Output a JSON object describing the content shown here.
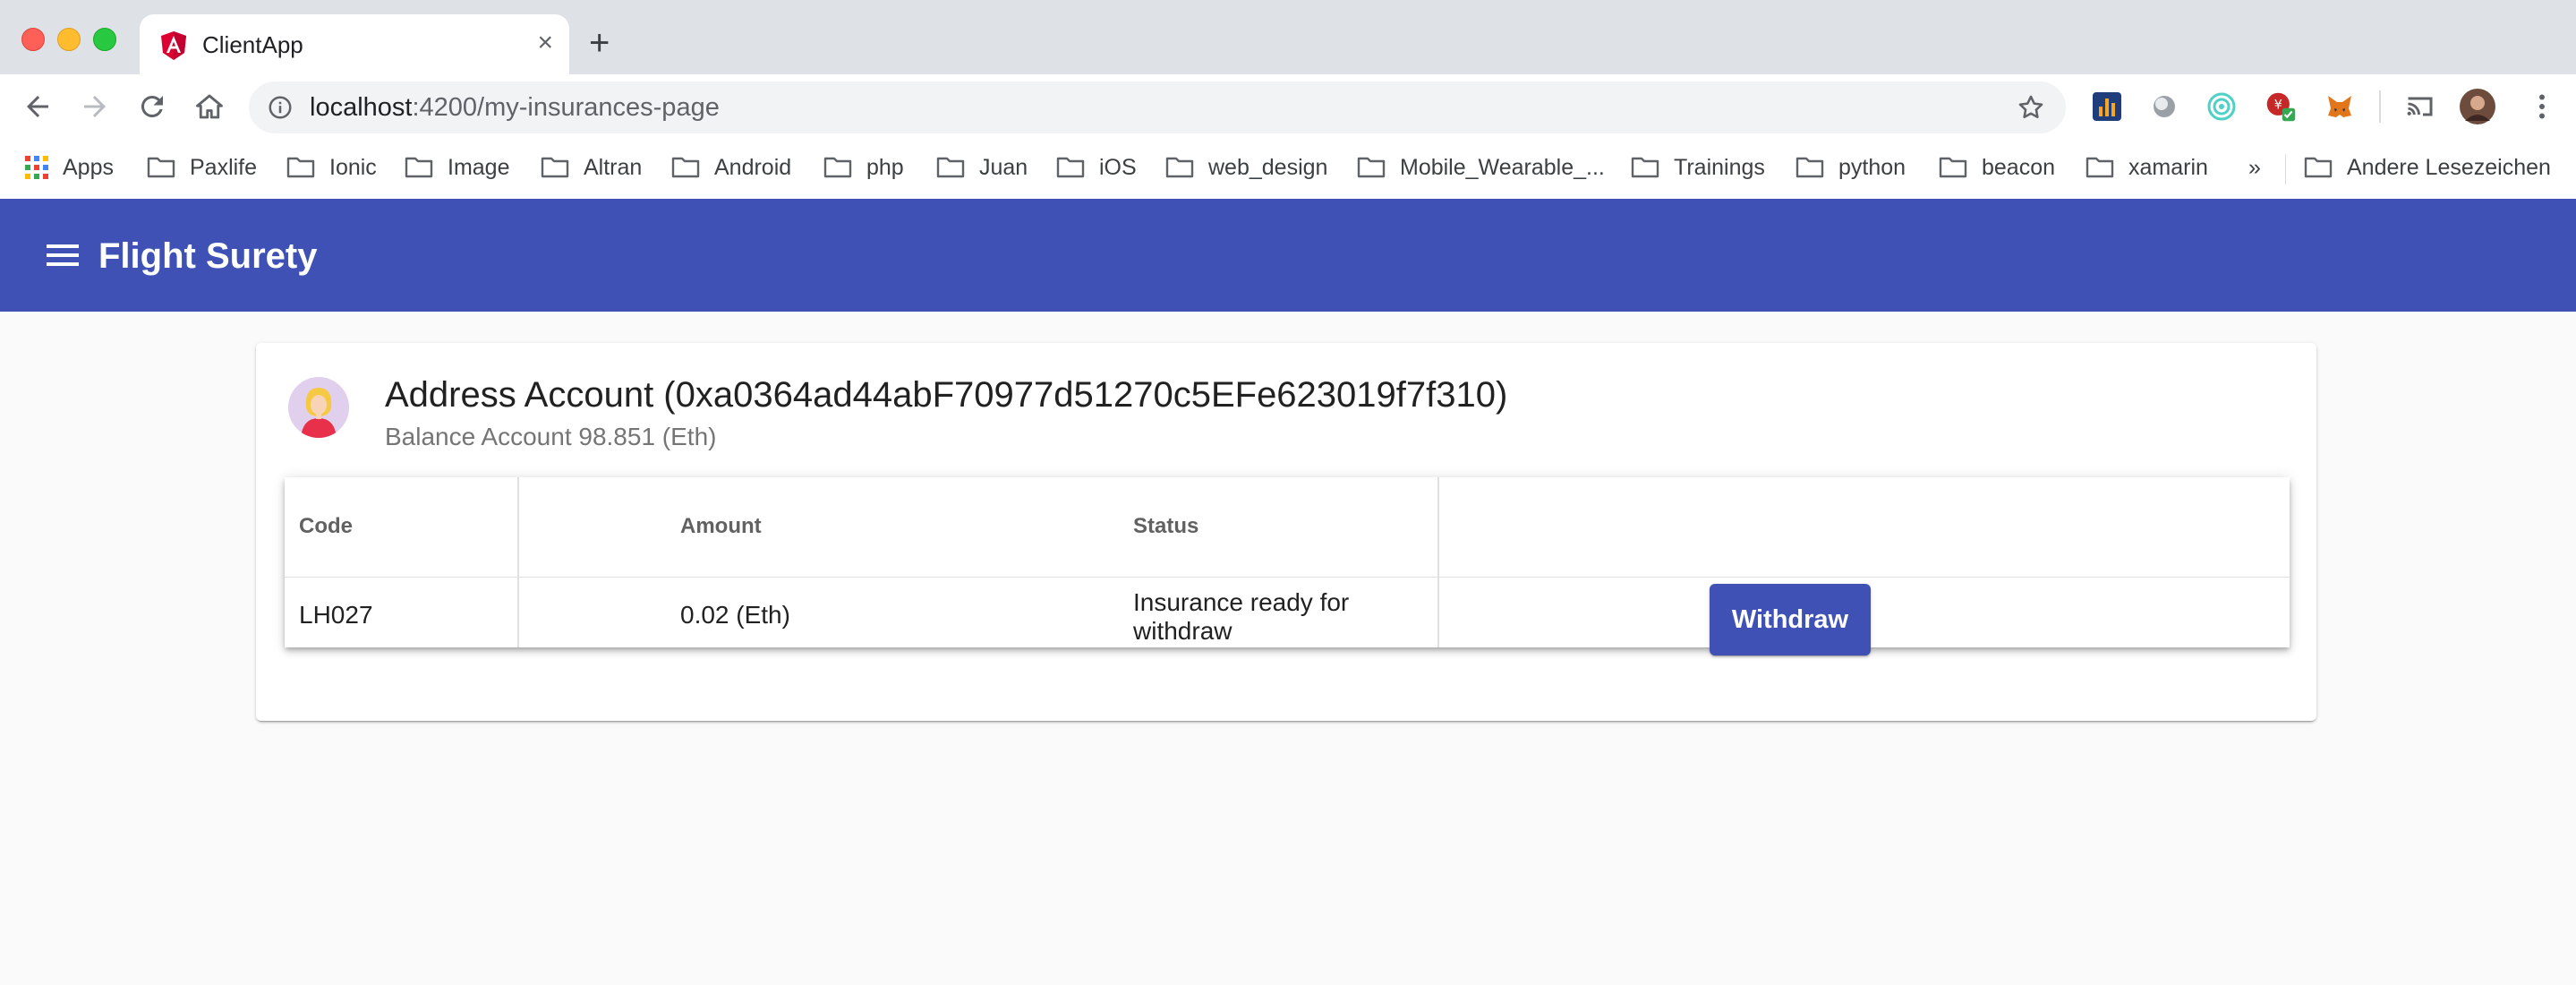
{
  "browser": {
    "tab_title": "ClientApp",
    "tab_close": "×",
    "new_tab": "+",
    "url_host": "localhost",
    "url_path": ":4200/my-insurances-page",
    "bookmarks": [
      "Apps",
      "Paxlife",
      "Ionic",
      "Image",
      "Altran",
      "Android",
      "php",
      "Juan",
      "iOS",
      "web_design",
      "Mobile_Wearable_...",
      "Trainings",
      "python",
      "beacon",
      "xamarin"
    ],
    "more_bookmarks": "»",
    "other_bookmarks": "Andere Lesezeichen",
    "colors": {
      "titlebar": "#dee1e6",
      "toolbar": "#ffffff"
    }
  },
  "app": {
    "title": "Flight Surety",
    "primary_color": "#3f51b5"
  },
  "account": {
    "title": "Address Account (0xa0364ad44abF70977d51270c5EFe623019f7f310)",
    "subtitle": "Balance Account 98.851 (Eth)"
  },
  "table": {
    "headers": {
      "code": "Code",
      "amount": "Amount",
      "status": "Status"
    },
    "rows": [
      {
        "code": "LH027",
        "amount": "0.02 (Eth)",
        "status_line1": "Insurance ready for",
        "status_line2": "withdraw",
        "action": "Withdraw"
      }
    ]
  }
}
